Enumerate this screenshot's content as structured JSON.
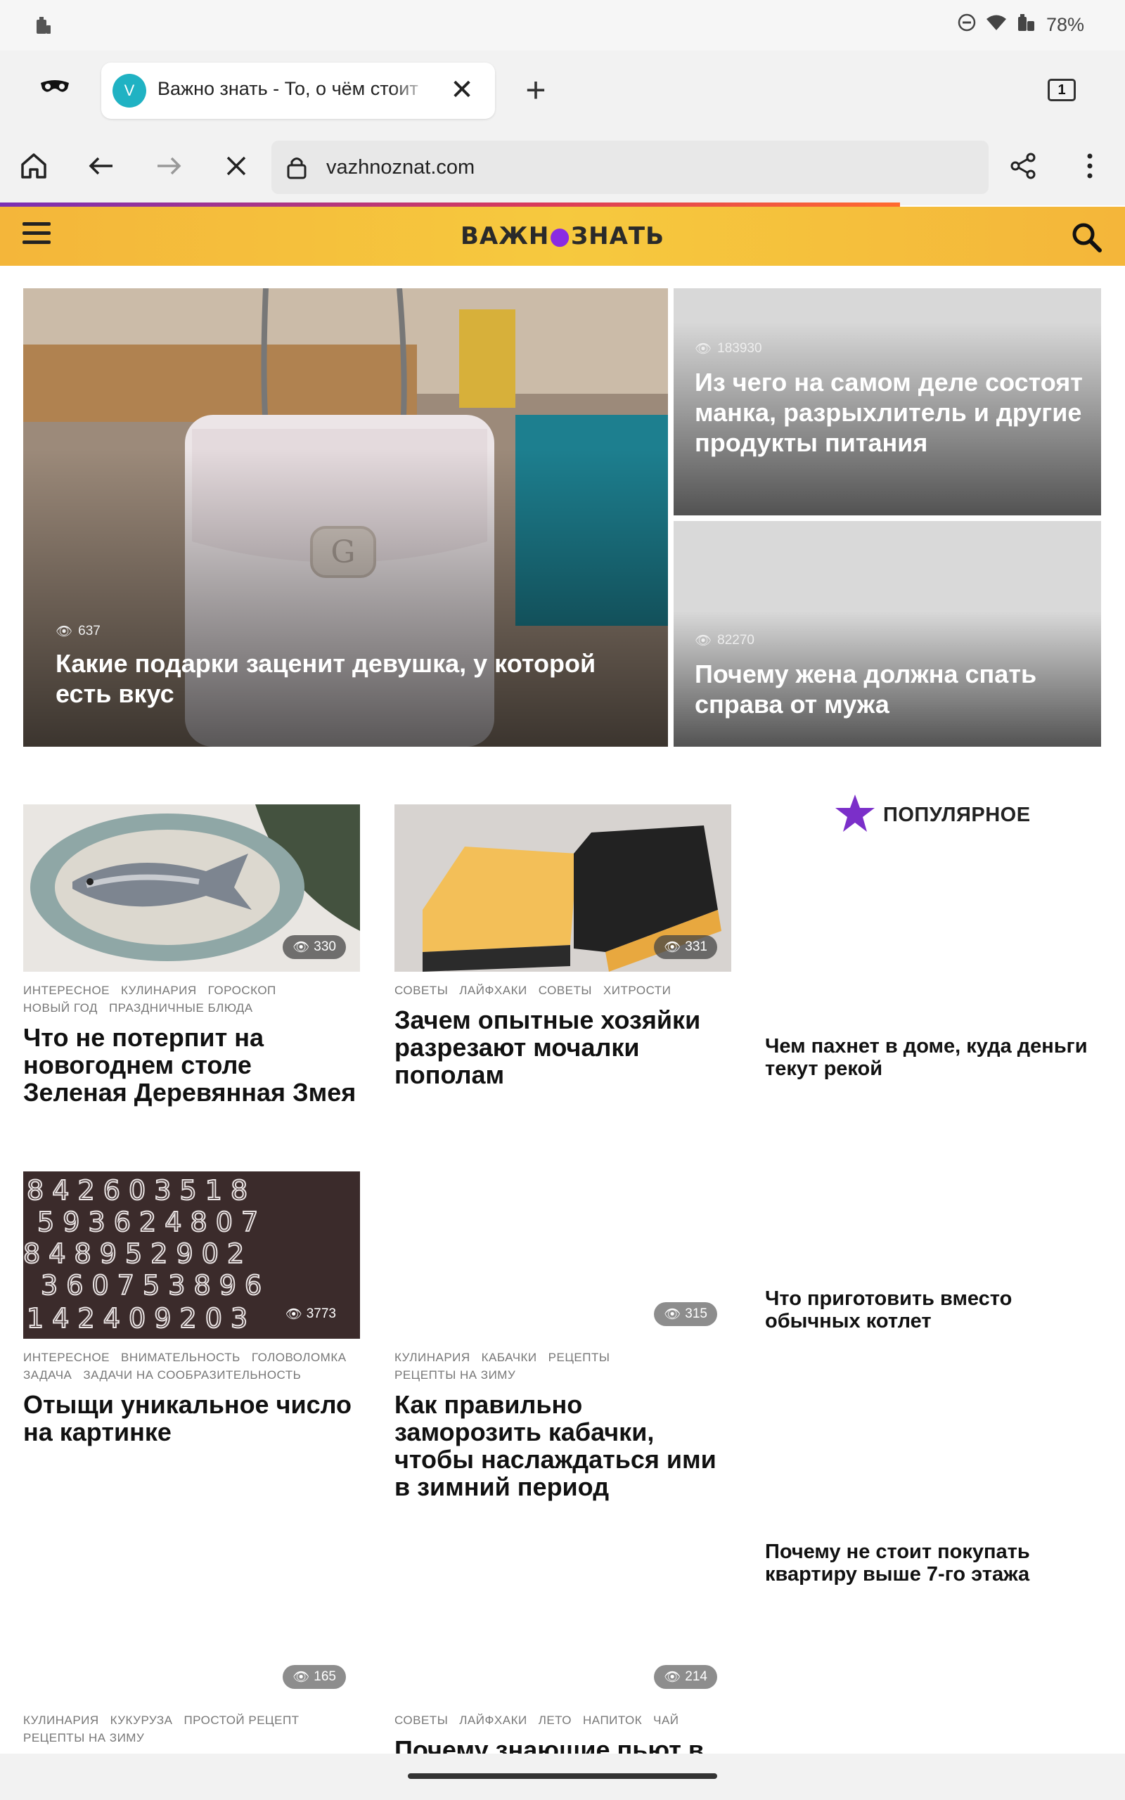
{
  "status_bar": {
    "battery": "78%"
  },
  "tab": {
    "favicon_letter": "V",
    "title": "Важно знать - То, о чём стоит",
    "close": "✕"
  },
  "tab_count": "1",
  "url": "vazhnoznat.com",
  "site": {
    "logo_left": "ВАЖН",
    "logo_dot": "●",
    "logo_right": "ЗНАТЬ"
  },
  "hero": {
    "main": {
      "views": "637",
      "title": "Какие подарки заценит девушка, у которой есть вкус"
    },
    "right_top": {
      "views": "183930",
      "title": "Из чего на самом деле состоят манка, разрыхлитель и другие продукты питания"
    },
    "right_bottom": {
      "views": "82270",
      "title": "Почему жена должна спать справа от мужа"
    }
  },
  "cards": [
    {
      "views": "330",
      "tags": [
        "Интересное",
        "Кулинария",
        "Гороскоп",
        "Новый год",
        "Праздничные блюда"
      ],
      "title": "Что не потерпит на новогоднем столе Зеленая Деревянная Змея"
    },
    {
      "views": "331",
      "tags": [
        "Советы",
        "Лайфхаки",
        "Советы",
        "Хитрости"
      ],
      "title": "Зачем опытные хозяйки разрезают мочалки пополам"
    },
    {
      "views": "3773",
      "tags": [
        "Интересное",
        "Внимательность",
        "Головоломка",
        "Задача",
        "Задачи на сообразительность"
      ],
      "title": "Отыщи уникальное число на картинке"
    },
    {
      "views": "315",
      "tags": [
        "Кулинария",
        "Кабачки",
        "Рецепты",
        "Рецепты на зиму"
      ],
      "title": "Как правильно заморозить кабачки, чтобы наслаждаться ими в зимний период"
    },
    {
      "views": "165",
      "tags": [
        "Кулинария",
        "Кукуруза",
        "Простой рецепт",
        "Рецепты на зиму"
      ],
      "title": ""
    },
    {
      "views": "214",
      "tags": [
        "Советы",
        "Лайфхаки",
        "Лето",
        "Напиток",
        "Чай"
      ],
      "title": "Почему знающие пьют в"
    }
  ],
  "popular": {
    "heading": "ПОПУЛЯРНОЕ",
    "items": [
      "Чем пахнет в доме, куда деньги текут рекой",
      "Что приготовить вместо обычных котлет",
      "Почему не стоит покупать квартиру выше 7-го этажа"
    ]
  },
  "colors": {
    "header_yellow": "#f6c93e",
    "accent_purple": "#7b2fc9"
  }
}
